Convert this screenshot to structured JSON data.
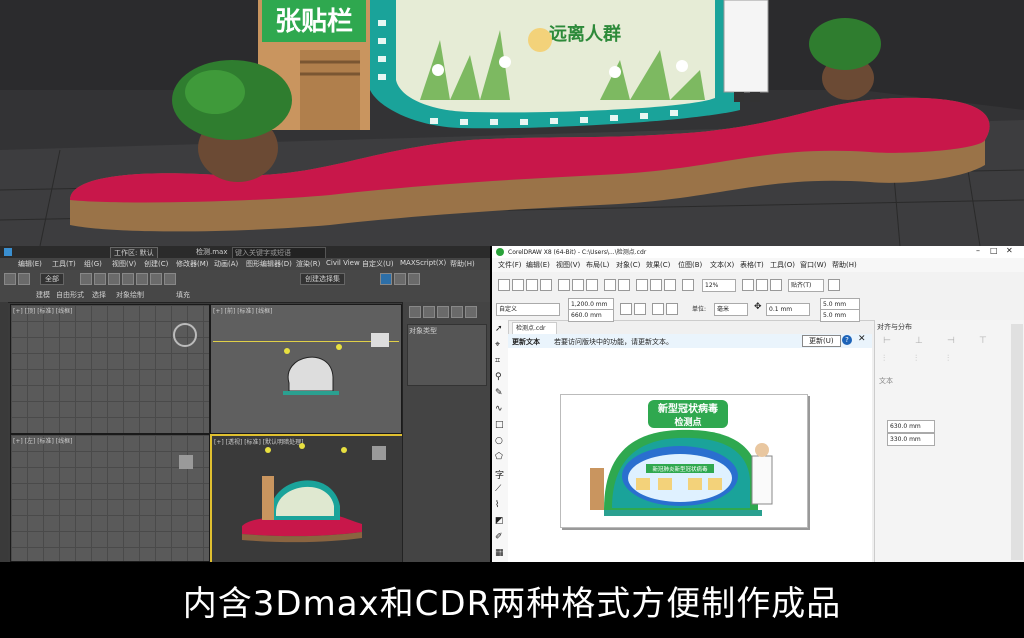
{
  "scene": {
    "board_title": "张贴栏",
    "side_heading": "远离人群",
    "colors": {
      "carpet": "#c8174a",
      "teal": "#1aa39a",
      "wood": "#9a7348",
      "green_frame": "#2fa84f"
    }
  },
  "max_window": {
    "title_field": "工作区: 默认",
    "file_name": "检测.max",
    "search_placeholder": "键入关键字或短语",
    "menus": [
      "编辑(E)",
      "工具(T)",
      "组(G)",
      "视图(V)",
      "创建(C)",
      "修改器(M)",
      "动画(A)",
      "图形编辑器(D)",
      "渲染(R)",
      "Civil View",
      "自定义(U)",
      "MAXScript(X)",
      "帮助(H)"
    ],
    "view_dropdown": "全部",
    "ribbon_tabs": [
      "建模",
      "自由形式",
      "选择",
      "对象绘制",
      "填充"
    ],
    "selection_label": "创建选择集",
    "command_panel_label": "对象类型",
    "viewport_labels": [
      "[+] [顶] [标准] [线框]",
      "[+] [前] [标准] [线框]",
      "[+] [左] [标准] [线框]",
      "[+] [透视] [标准] [默认明暗处理]"
    ]
  },
  "cdr_window": {
    "title": "CorelDRAW X8 (64-Bit) - C:\\Users\\...\\检测点.cdr",
    "menus": [
      "文件(F)",
      "编辑(E)",
      "视图(V)",
      "布局(L)",
      "对象(C)",
      "效果(C)",
      "位图(B)",
      "文本(X)",
      "表格(T)",
      "工具(O)",
      "窗口(W)",
      "帮助(H)"
    ],
    "zoom": "12%",
    "snap_label": "贴齐(T)",
    "preset": "自定义",
    "width_field": "1,200.0 mm",
    "height_field": "660.0 mm",
    "units_label": "单位:",
    "units_value": "毫米",
    "nudge_value": "0.1 mm",
    "dup_x": "5.0 mm",
    "dup_y": "5.0 mm",
    "doc_tab": "检测点.cdr",
    "hint_title": "更新文本",
    "hint_text": "若要访问版块中的功能，请更新文本。",
    "update_button": "更新(U)",
    "docker_title": "对齐与分布",
    "docker_section": "文本",
    "docker_x": "630.0 mm",
    "docker_y": "330.0 mm",
    "sign_heading_1": "新型冠状病毒",
    "sign_heading_2": "检测点",
    "sign_sub": "新冠肺炎新型冠状病毒"
  },
  "caption": "内含3Dmax和CDR两种格式方便制作成品"
}
